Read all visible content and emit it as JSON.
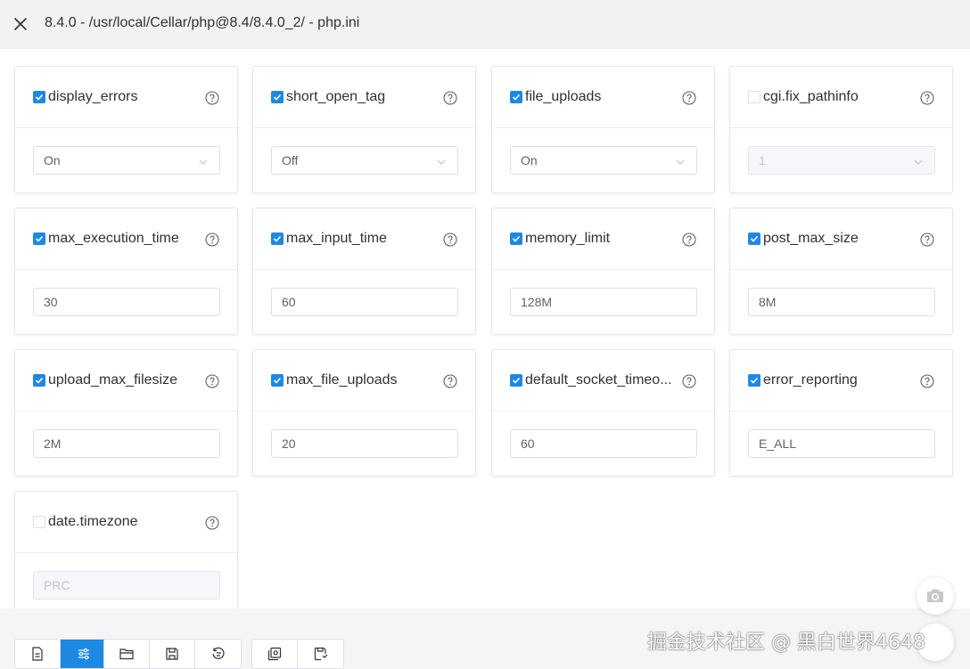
{
  "window": {
    "title": "8.4.0 - /usr/local/Cellar/php@8.4/8.4.0_2/ - php.ini",
    "close_icon": "close-icon"
  },
  "settings": [
    {
      "key": "display_errors",
      "enabled": true,
      "value": "On",
      "type": "select",
      "disabled": false
    },
    {
      "key": "short_open_tag",
      "enabled": true,
      "value": "Off",
      "type": "select",
      "disabled": false
    },
    {
      "key": "file_uploads",
      "enabled": true,
      "value": "On",
      "type": "select",
      "disabled": false
    },
    {
      "key": "cgi.fix_pathinfo",
      "enabled": false,
      "value": "1",
      "type": "select",
      "disabled": true
    },
    {
      "key": "max_execution_time",
      "enabled": true,
      "value": "30",
      "type": "input",
      "disabled": false
    },
    {
      "key": "max_input_time",
      "enabled": true,
      "value": "60",
      "type": "input",
      "disabled": false
    },
    {
      "key": "memory_limit",
      "enabled": true,
      "value": "128M",
      "type": "input",
      "disabled": false
    },
    {
      "key": "post_max_size",
      "enabled": true,
      "value": "8M",
      "type": "input",
      "disabled": false
    },
    {
      "key": "upload_max_filesize",
      "enabled": true,
      "value": "2M",
      "type": "input",
      "disabled": false
    },
    {
      "key": "max_file_uploads",
      "enabled": true,
      "value": "20",
      "type": "input",
      "disabled": false
    },
    {
      "key": "default_socket_timeo...",
      "enabled": true,
      "value": "60",
      "type": "input",
      "disabled": false
    },
    {
      "key": "error_reporting",
      "enabled": true,
      "value": "E_ALL",
      "type": "input",
      "disabled": false
    },
    {
      "key": "date.timezone",
      "enabled": false,
      "value": "PRC",
      "type": "input",
      "disabled": true
    }
  ],
  "toolbar": {
    "groups": [
      [
        "document-icon",
        "sliders-icon"
      ],
      [
        "folder-icon",
        "save-icon",
        "history-icon"
      ],
      [
        "load-config-icon",
        "save-config-icon"
      ]
    ],
    "active": "sliders-icon"
  },
  "watermark": "掘金技术社区 @ 黑白世界4648",
  "colors": {
    "accent": "#1e88e5",
    "border": "#dcdfe6",
    "text": "#303133"
  }
}
